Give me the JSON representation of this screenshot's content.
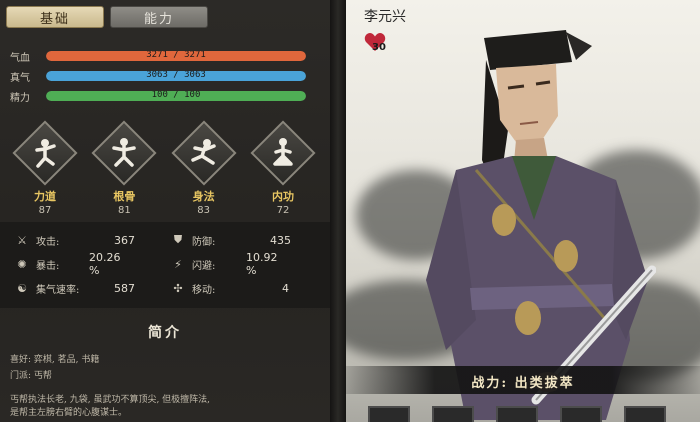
{
  "tabs": [
    {
      "label": "基础",
      "active": true
    },
    {
      "label": "能力",
      "active": false
    }
  ],
  "bars": [
    {
      "label": "气血",
      "current": 3271,
      "max": 3271,
      "text": "3271 / 3271",
      "color": "#e0673c"
    },
    {
      "label": "真气",
      "current": 3063,
      "max": 3063,
      "text": "3063 / 3063",
      "color": "#4aa3d8"
    },
    {
      "label": "精力",
      "current": 100,
      "max": 100,
      "text": "100 / 100",
      "color": "#4fae55"
    }
  ],
  "attributes": [
    {
      "name": "力道",
      "value": "87",
      "icon": "strength-figure-icon"
    },
    {
      "name": "根骨",
      "value": "81",
      "icon": "constitution-figure-icon"
    },
    {
      "name": "身法",
      "value": "83",
      "icon": "agility-figure-icon"
    },
    {
      "name": "内功",
      "value": "72",
      "icon": "inner-power-figure-icon"
    }
  ],
  "stats": {
    "attack": {
      "label": "攻击:",
      "value": "367",
      "icon": "sword-icon"
    },
    "defense": {
      "label": "防御:",
      "value": "435",
      "icon": "armor-icon"
    },
    "crit": {
      "label": "暴击:",
      "value": "20.26 %",
      "icon": "crit-icon"
    },
    "dodge": {
      "label": "闪避:",
      "value": "10.92 %",
      "icon": "boot-icon"
    },
    "qi_rate": {
      "label": "集气速率:",
      "value": "587",
      "icon": "qi-icon"
    },
    "move": {
      "label": "移动:",
      "value": "4",
      "icon": "move-icon"
    }
  },
  "intro": {
    "title": "简介",
    "hobby": "喜好: 弈棋, 茗品, 书籍",
    "sect": "门派: 丐帮",
    "desc1": "丐帮执法长老, 九袋, 虽武功不算顶尖, 但极擅阵法,",
    "desc2": "是帮主左膀右臂的心腹谋士。"
  },
  "character": {
    "name": "李元兴",
    "favor": "30",
    "power_label": "战力: 出类拔萃"
  },
  "colors": {
    "tab_active": "#d8c9a0",
    "attr_name": "#e8c662"
  }
}
